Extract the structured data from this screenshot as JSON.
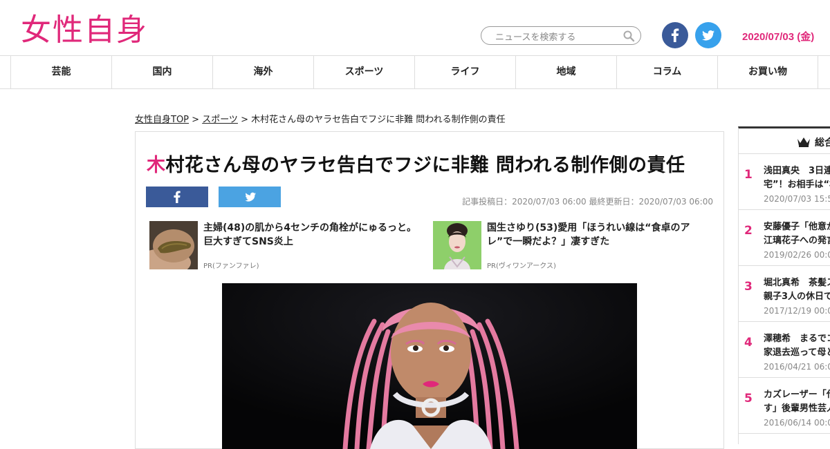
{
  "header": {
    "logo": "女性自身",
    "search_placeholder": "ニュースを検索する",
    "date": "2020/07/03 (金)",
    "facebook_icon": "facebook-icon",
    "twitter_icon": "twitter-icon",
    "accent_color": "#e0287a"
  },
  "nav": {
    "items": [
      "芸能",
      "国内",
      "海外",
      "スポーツ",
      "ライフ",
      "地域",
      "コラム",
      "お買い物"
    ]
  },
  "breadcrumb": {
    "home": "女性自身TOP",
    "sep1": " > ",
    "category": "スポーツ",
    "sep2": " > ",
    "current": "木村花さん母のヤラセ告白でフジに非難 問われる制作側の責任"
  },
  "article": {
    "title_first": "木",
    "title_rest": "村花さん母のヤラセ告白でフジに非難 問われる制作側の責任",
    "posted": "記事投稿日：2020/07/03 06:00 最終更新日：2020/07/03 06:00",
    "share_facebook_color": "#3a5a99",
    "share_twitter_color": "#4ba3e2"
  },
  "pr": [
    {
      "text": "主婦(48)の肌から4センチの角栓がにゅるっと。巨大すぎてSNS炎上",
      "source": "PR(ファンファレ)"
    },
    {
      "text": "国生さゆり(53)愛用「ほうれい線は“食卓のアレ”で一瞬だよ？」凄すぎた",
      "source": "PR(ヴィワンアークス)"
    }
  ],
  "ranking": {
    "title": "総合",
    "items": [
      {
        "num": "1",
        "line1": "浅田真央　3日連",
        "line2": "宅”！お相手は“村",
        "date": "2020/07/03 15:50"
      },
      {
        "num": "2",
        "line1": "安藤優子「他意が",
        "line2": "江璃花子への発言",
        "date": "2019/02/26 00:00"
      },
      {
        "num": "3",
        "line1": "堀北真希　茶髪ス",
        "line2": "親子3人の休日で",
        "date": "2017/12/19 00:00"
      },
      {
        "num": "4",
        "line1": "澤穂希　まるでコ",
        "line2": "家退去巡って母と",
        "date": "2016/04/21 06:00"
      },
      {
        "num": "5",
        "line1": "カズレーザー「代",
        "line2": "す」後輩男性芸人",
        "date": "2016/06/14 00:00"
      }
    ]
  }
}
